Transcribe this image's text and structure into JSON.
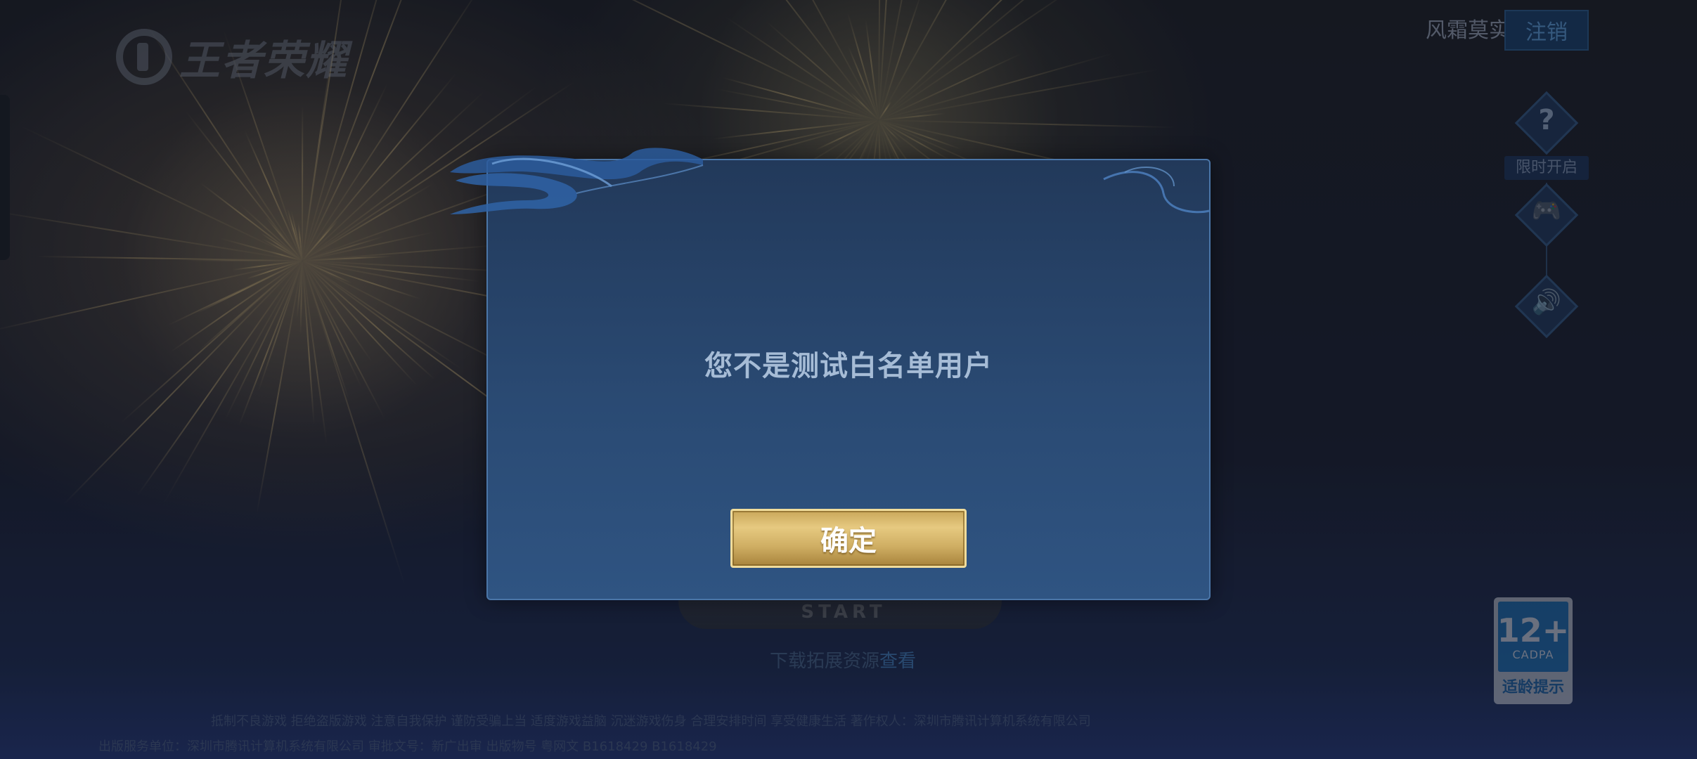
{
  "app": {
    "logo_text": "王者荣耀"
  },
  "header": {
    "account_name": "风霜莫实颜",
    "logout_label": "注销"
  },
  "side_controls": {
    "help_glyph": "?",
    "caption": "限时开启",
    "gamepad_glyph": "🎮",
    "sound_glyph": "🔊"
  },
  "main": {
    "start_label": "START",
    "download_text": "下载拓展资源",
    "download_link": "查看"
  },
  "age_rating": {
    "age": "12+",
    "org": "CADPA",
    "tip": "适龄提示"
  },
  "footer": {
    "line1": "抵制不良游戏 拒绝盗版游戏 注意自我保护 谨防受骗上当 适度游戏益脑 沉迷游戏伤身 合理安排时间 享受健康生活 著作权人：深圳市腾讯计算机系统有限公司",
    "line2": "出版服务单位：深圳市腾讯计算机系统有限公司 审批文号：新广出审 出版物号 粤网文 B1618429 B1618429"
  },
  "dialog": {
    "message": "您不是测试白名单用户",
    "confirm_label": "确定"
  },
  "colors": {
    "dialog_bg": "#2a4a73",
    "dialog_border": "#4b76a8",
    "confirm_gold": "#e6c980",
    "message_text": "#a6bcd6"
  }
}
